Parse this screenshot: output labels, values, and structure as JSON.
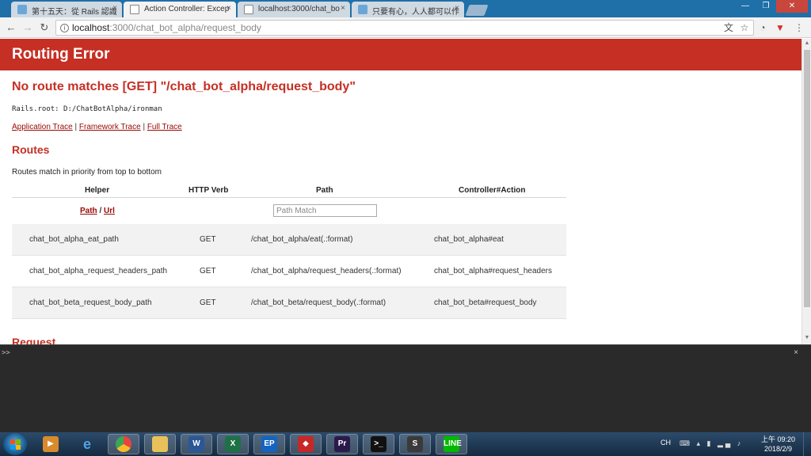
{
  "tabs": [
    {
      "title": "第十五天：從 Rails 認識",
      "close": "×"
    },
    {
      "title": "Action Controller: Excep",
      "close": "×"
    },
    {
      "title": "localhost:3000/chat_bo",
      "close": "×"
    },
    {
      "title": "只要有心，人人都可以作",
      "close": "×"
    }
  ],
  "window_controls": {
    "minimize": "—",
    "restore": "❐",
    "close": "✕"
  },
  "address_bar": {
    "host": "localhost",
    "path": ":3000/chat_bot_alpha/request_body"
  },
  "page": {
    "banner_title": "Routing Error",
    "error_title": "No route matches [GET] \"/chat_bot_alpha/request_body\"",
    "rails_root": "Rails.root: D:/ChatBotAlpha/ironman",
    "traces": [
      "Application Trace",
      "Framework Trace",
      "Full Trace"
    ],
    "trace_separator": " | ",
    "routes_heading": "Routes",
    "routes_note": "Routes match in priority from top to bottom",
    "table": {
      "headers": [
        "Helper",
        "HTTP Verb",
        "Path",
        "Controller#Action"
      ],
      "filter_links": [
        "Path",
        "Url"
      ],
      "filter_separator": " / ",
      "filter_placeholder": "Path Match",
      "rows": [
        {
          "helper": "chat_bot_alpha_eat_path",
          "verb": "GET",
          "path": "/chat_bot_alpha/eat(.:format)",
          "action": "chat_bot_alpha#eat"
        },
        {
          "helper": "chat_bot_alpha_request_headers_path",
          "verb": "GET",
          "path": "/chat_bot_alpha/request_headers(.:format)",
          "action": "chat_bot_alpha#request_headers"
        },
        {
          "helper": "chat_bot_beta_request_body_path",
          "verb": "GET",
          "path": "/chat_bot_beta/request_body(.:format)",
          "action": "chat_bot_beta#request_body"
        }
      ]
    },
    "request_heading": "Request"
  },
  "console": {
    "prompt": ">>",
    "close": "×"
  },
  "taskbar": {
    "apps": [
      {
        "name": "media-player",
        "label": "▶",
        "color": "#d98a2b"
      },
      {
        "name": "internet-explorer",
        "label": "e",
        "color": "#1e7fd6"
      },
      {
        "name": "chrome",
        "label": "",
        "color": "#e8453c"
      },
      {
        "name": "file-explorer",
        "label": "",
        "color": "#e8c15a"
      },
      {
        "name": "word",
        "label": "W",
        "color": "#2b5797"
      },
      {
        "name": "excel",
        "label": "X",
        "color": "#1e7145"
      },
      {
        "name": "ep",
        "label": "EP",
        "color": "#1565c0"
      },
      {
        "name": "red-app",
        "label": "◆",
        "color": "#c62828"
      },
      {
        "name": "premiere",
        "label": "Pr",
        "color": "#2a1a4a"
      },
      {
        "name": "cmd",
        "label": ">_",
        "color": "#111111"
      },
      {
        "name": "sublime",
        "label": "S",
        "color": "#3a3a3a"
      },
      {
        "name": "line",
        "label": "LINE",
        "color": "#00b900"
      }
    ],
    "ime": "CH",
    "clock_time": "上午 09:20",
    "clock_date": "2018/2/9"
  },
  "colors": {
    "rails_red": "#c52f24",
    "link": "#980905"
  }
}
